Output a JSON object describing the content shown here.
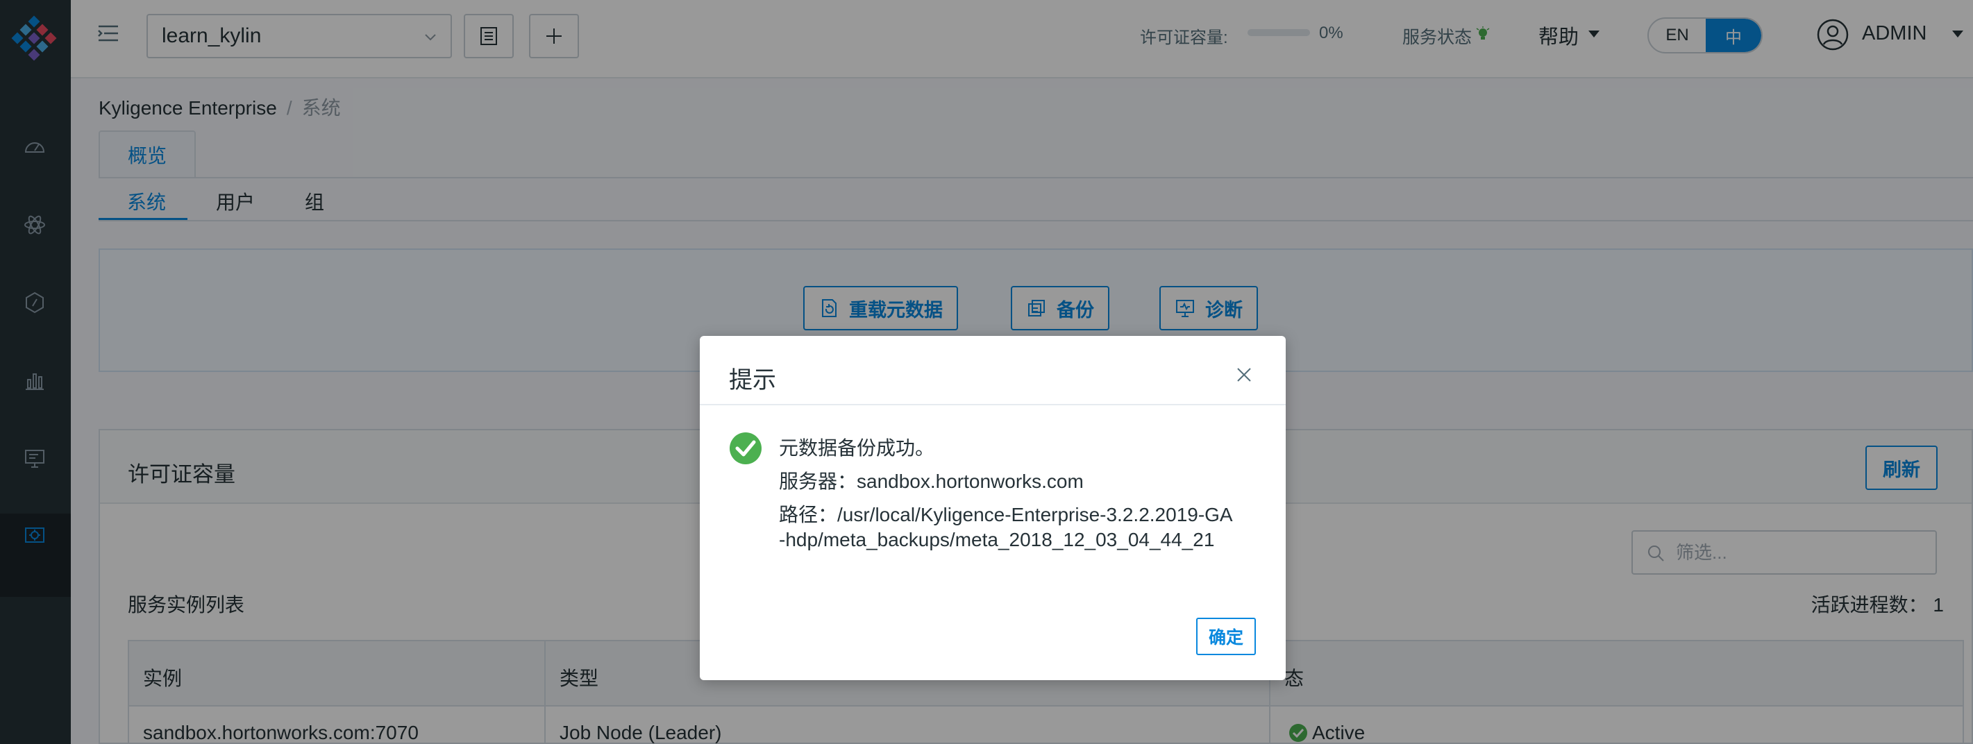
{
  "header": {
    "project": "learn_kylin",
    "license_label": "许可证容量:",
    "license_percent": "0%",
    "license_fraction": 0,
    "service_status_label": "服务状态",
    "help_label": "帮助",
    "lang_en": "EN",
    "lang_zh": "中",
    "user_name": "ADMIN"
  },
  "breadcrumb": {
    "root": "Kyligence Enterprise",
    "separator": "/",
    "current": "系统"
  },
  "tabs": {
    "overview": "概览",
    "subtabs": [
      "系统",
      "用户",
      "组"
    ]
  },
  "actions": {
    "reload": "重载元数据",
    "backup": "备份",
    "diagnose": "诊断"
  },
  "license_card": {
    "title": "许可证容量",
    "refresh": "刷新",
    "filter_placeholder": "筛选...",
    "instances_title": "服务实例列表",
    "active_processes": "活跃进程数： 1",
    "columns": [
      "实例",
      "类型",
      "态"
    ],
    "rows": [
      {
        "instance": "sandbox.hortonworks.com:7070",
        "type": "Job Node (Leader)",
        "status": "Active"
      }
    ]
  },
  "dialog": {
    "title": "提示",
    "line1": "元数据备份成功。",
    "line2": "服务器：sandbox.hortonworks.com",
    "line3": "路径：/usr/local/Kyligence-Enterprise-3.2.2.2019-GA",
    "line4": "-hdp/meta_backups/meta_2018_12_03_04_44_21",
    "confirm": "确定"
  },
  "colors": {
    "accent": "#0988de",
    "sidebar": "#263238",
    "success": "#4cb050"
  }
}
